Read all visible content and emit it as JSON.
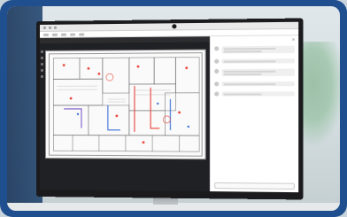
{
  "app": {
    "logo_text": "",
    "panel_title": "",
    "comments": [
      {
        "name": "",
        "text": ""
      },
      {
        "name": "",
        "text": ""
      },
      {
        "name": "",
        "text": ""
      },
      {
        "name": "",
        "text": ""
      },
      {
        "name": "",
        "text": ""
      }
    ]
  },
  "colors": {
    "frame": "#1f4f8f",
    "markup_red": "#e8443a",
    "markup_blue": "#3a6fd8",
    "markup_purple": "#7a5cc7"
  }
}
